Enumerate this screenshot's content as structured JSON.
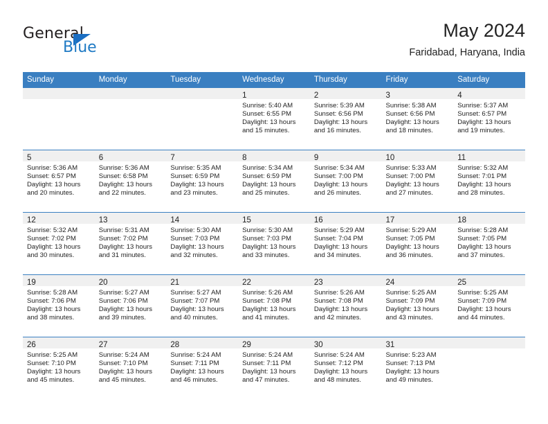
{
  "brand": {
    "name_part1": "General",
    "name_part2": "Blue",
    "accent_color": "#1f7ac4",
    "triangle_icon": "triangle-icon"
  },
  "header": {
    "title": "May 2024",
    "subtitle": "Faridabad, Haryana, India"
  },
  "colors": {
    "header_row_bg": "#3a7fc1",
    "day_band_bg": "#f0f0f0",
    "text": "#1f1f1f",
    "page_bg": "#ffffff"
  },
  "weekday_headers": [
    "Sunday",
    "Monday",
    "Tuesday",
    "Wednesday",
    "Thursday",
    "Friday",
    "Saturday"
  ],
  "weeks": [
    [
      {
        "day": "",
        "lines": []
      },
      {
        "day": "",
        "lines": []
      },
      {
        "day": "",
        "lines": []
      },
      {
        "day": "1",
        "lines": [
          "Sunrise: 5:40 AM",
          "Sunset: 6:55 PM",
          "Daylight: 13 hours",
          "and 15 minutes."
        ]
      },
      {
        "day": "2",
        "lines": [
          "Sunrise: 5:39 AM",
          "Sunset: 6:56 PM",
          "Daylight: 13 hours",
          "and 16 minutes."
        ]
      },
      {
        "day": "3",
        "lines": [
          "Sunrise: 5:38 AM",
          "Sunset: 6:56 PM",
          "Daylight: 13 hours",
          "and 18 minutes."
        ]
      },
      {
        "day": "4",
        "lines": [
          "Sunrise: 5:37 AM",
          "Sunset: 6:57 PM",
          "Daylight: 13 hours",
          "and 19 minutes."
        ]
      }
    ],
    [
      {
        "day": "5",
        "lines": [
          "Sunrise: 5:36 AM",
          "Sunset: 6:57 PM",
          "Daylight: 13 hours",
          "and 20 minutes."
        ]
      },
      {
        "day": "6",
        "lines": [
          "Sunrise: 5:36 AM",
          "Sunset: 6:58 PM",
          "Daylight: 13 hours",
          "and 22 minutes."
        ]
      },
      {
        "day": "7",
        "lines": [
          "Sunrise: 5:35 AM",
          "Sunset: 6:59 PM",
          "Daylight: 13 hours",
          "and 23 minutes."
        ]
      },
      {
        "day": "8",
        "lines": [
          "Sunrise: 5:34 AM",
          "Sunset: 6:59 PM",
          "Daylight: 13 hours",
          "and 25 minutes."
        ]
      },
      {
        "day": "9",
        "lines": [
          "Sunrise: 5:34 AM",
          "Sunset: 7:00 PM",
          "Daylight: 13 hours",
          "and 26 minutes."
        ]
      },
      {
        "day": "10",
        "lines": [
          "Sunrise: 5:33 AM",
          "Sunset: 7:00 PM",
          "Daylight: 13 hours",
          "and 27 minutes."
        ]
      },
      {
        "day": "11",
        "lines": [
          "Sunrise: 5:32 AM",
          "Sunset: 7:01 PM",
          "Daylight: 13 hours",
          "and 28 minutes."
        ]
      }
    ],
    [
      {
        "day": "12",
        "lines": [
          "Sunrise: 5:32 AM",
          "Sunset: 7:02 PM",
          "Daylight: 13 hours",
          "and 30 minutes."
        ]
      },
      {
        "day": "13",
        "lines": [
          "Sunrise: 5:31 AM",
          "Sunset: 7:02 PM",
          "Daylight: 13 hours",
          "and 31 minutes."
        ]
      },
      {
        "day": "14",
        "lines": [
          "Sunrise: 5:30 AM",
          "Sunset: 7:03 PM",
          "Daylight: 13 hours",
          "and 32 minutes."
        ]
      },
      {
        "day": "15",
        "lines": [
          "Sunrise: 5:30 AM",
          "Sunset: 7:03 PM",
          "Daylight: 13 hours",
          "and 33 minutes."
        ]
      },
      {
        "day": "16",
        "lines": [
          "Sunrise: 5:29 AM",
          "Sunset: 7:04 PM",
          "Daylight: 13 hours",
          "and 34 minutes."
        ]
      },
      {
        "day": "17",
        "lines": [
          "Sunrise: 5:29 AM",
          "Sunset: 7:05 PM",
          "Daylight: 13 hours",
          "and 36 minutes."
        ]
      },
      {
        "day": "18",
        "lines": [
          "Sunrise: 5:28 AM",
          "Sunset: 7:05 PM",
          "Daylight: 13 hours",
          "and 37 minutes."
        ]
      }
    ],
    [
      {
        "day": "19",
        "lines": [
          "Sunrise: 5:28 AM",
          "Sunset: 7:06 PM",
          "Daylight: 13 hours",
          "and 38 minutes."
        ]
      },
      {
        "day": "20",
        "lines": [
          "Sunrise: 5:27 AM",
          "Sunset: 7:06 PM",
          "Daylight: 13 hours",
          "and 39 minutes."
        ]
      },
      {
        "day": "21",
        "lines": [
          "Sunrise: 5:27 AM",
          "Sunset: 7:07 PM",
          "Daylight: 13 hours",
          "and 40 minutes."
        ]
      },
      {
        "day": "22",
        "lines": [
          "Sunrise: 5:26 AM",
          "Sunset: 7:08 PM",
          "Daylight: 13 hours",
          "and 41 minutes."
        ]
      },
      {
        "day": "23",
        "lines": [
          "Sunrise: 5:26 AM",
          "Sunset: 7:08 PM",
          "Daylight: 13 hours",
          "and 42 minutes."
        ]
      },
      {
        "day": "24",
        "lines": [
          "Sunrise: 5:25 AM",
          "Sunset: 7:09 PM",
          "Daylight: 13 hours",
          "and 43 minutes."
        ]
      },
      {
        "day": "25",
        "lines": [
          "Sunrise: 5:25 AM",
          "Sunset: 7:09 PM",
          "Daylight: 13 hours",
          "and 44 minutes."
        ]
      }
    ],
    [
      {
        "day": "26",
        "lines": [
          "Sunrise: 5:25 AM",
          "Sunset: 7:10 PM",
          "Daylight: 13 hours",
          "and 45 minutes."
        ]
      },
      {
        "day": "27",
        "lines": [
          "Sunrise: 5:24 AM",
          "Sunset: 7:10 PM",
          "Daylight: 13 hours",
          "and 45 minutes."
        ]
      },
      {
        "day": "28",
        "lines": [
          "Sunrise: 5:24 AM",
          "Sunset: 7:11 PM",
          "Daylight: 13 hours",
          "and 46 minutes."
        ]
      },
      {
        "day": "29",
        "lines": [
          "Sunrise: 5:24 AM",
          "Sunset: 7:11 PM",
          "Daylight: 13 hours",
          "and 47 minutes."
        ]
      },
      {
        "day": "30",
        "lines": [
          "Sunrise: 5:24 AM",
          "Sunset: 7:12 PM",
          "Daylight: 13 hours",
          "and 48 minutes."
        ]
      },
      {
        "day": "31",
        "lines": [
          "Sunrise: 5:23 AM",
          "Sunset: 7:13 PM",
          "Daylight: 13 hours",
          "and 49 minutes."
        ]
      },
      {
        "day": "",
        "lines": []
      }
    ]
  ]
}
